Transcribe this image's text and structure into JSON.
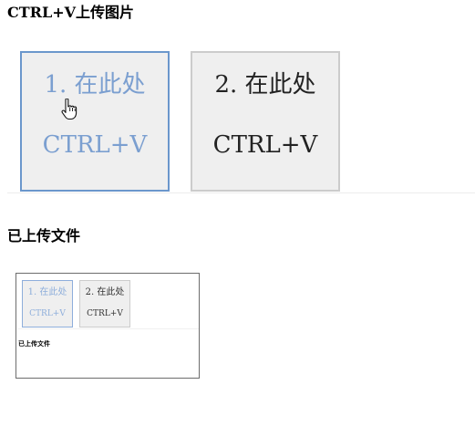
{
  "page": {
    "upload_title": "CTRL+V上传图片",
    "uploaded_title": "已上传文件"
  },
  "paste_boxes": [
    {
      "label": "1. 在此处",
      "shortcut": "CTRL+V",
      "state": "active",
      "color": "#7b9fd0"
    },
    {
      "label": "2. 在此处",
      "shortcut": "CTRL+V",
      "state": "idle",
      "color": "#222222"
    }
  ],
  "cursor": {
    "icon": "hand-pointer-icon"
  },
  "uploaded_files": [
    {
      "boxes": [
        {
          "label": "1. 在此处",
          "shortcut": "CTRL+V"
        },
        {
          "label": "2. 在此处",
          "shortcut": "CTRL+V"
        }
      ],
      "heading": "已上传文件"
    }
  ],
  "colors": {
    "active_border": "#6b97cc",
    "idle_border": "#cccccc",
    "box_background": "#efefef"
  }
}
